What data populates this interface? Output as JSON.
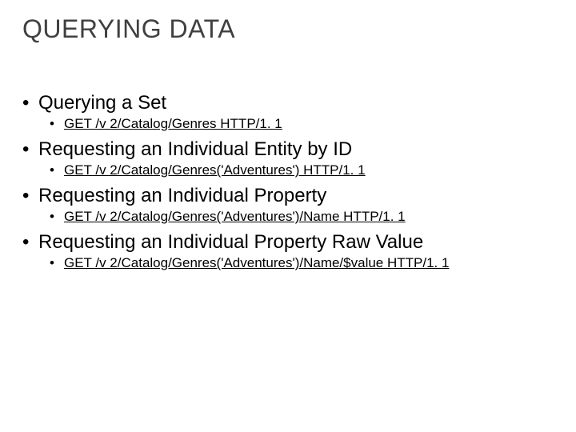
{
  "title": "QUERYING DATA",
  "sections": [
    {
      "heading": "Querying a Set",
      "link": "GET /v 2/Catalog/Genres HTTP/1. 1"
    },
    {
      "heading": "Requesting an Individual Entity by ID",
      "link": "GET /v 2/Catalog/Genres('Adventures') HTTP/1. 1"
    },
    {
      "heading": "Requesting an Individual Property",
      "link": "GET /v 2/Catalog/Genres('Adventures')/Name HTTP/1. 1"
    },
    {
      "heading": "Requesting an Individual Property Raw Value",
      "link": "GET /v 2/Catalog/Genres('Adventures')/Name/$value HTTP/1. 1"
    }
  ]
}
